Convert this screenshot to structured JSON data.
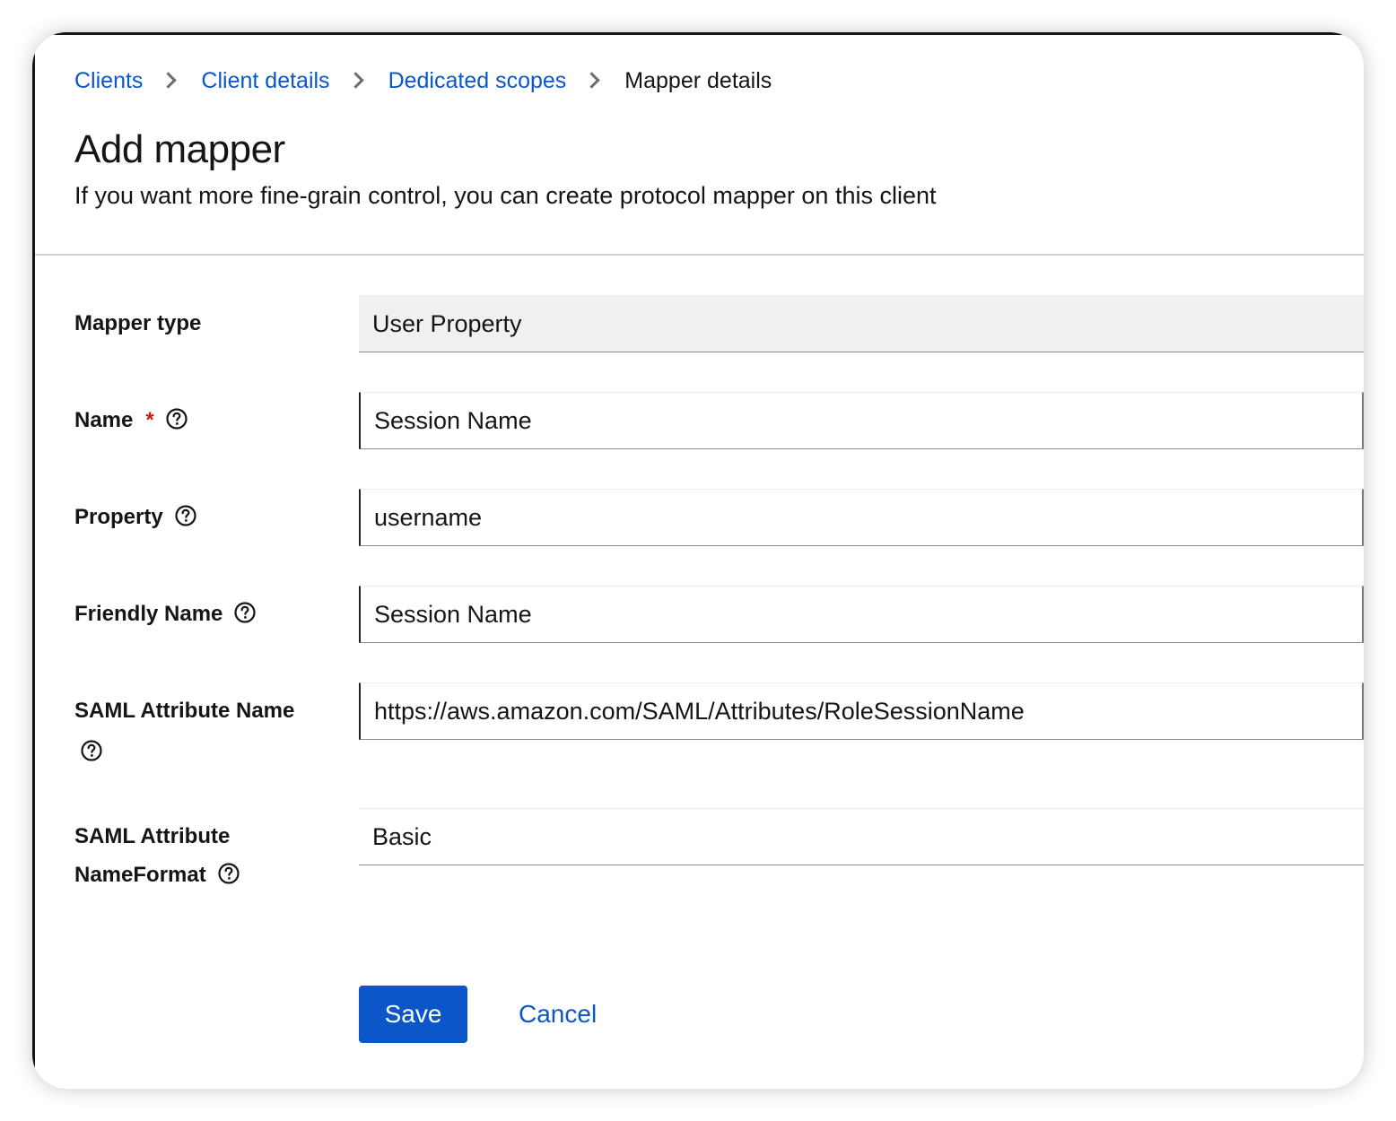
{
  "breadcrumb": {
    "items": [
      {
        "label": "Clients",
        "link": true
      },
      {
        "label": "Client details",
        "link": true
      },
      {
        "label": "Dedicated scopes",
        "link": true
      },
      {
        "label": "Mapper details",
        "link": false
      }
    ]
  },
  "header": {
    "title": "Add mapper",
    "subtitle": "If you want more fine-grain control, you can create protocol mapper on this client"
  },
  "form": {
    "mapper_type": {
      "label": "Mapper type",
      "value": "User Property"
    },
    "name": {
      "label": "Name",
      "required_mark": "*",
      "value": "Session Name"
    },
    "property": {
      "label": "Property",
      "value": "username"
    },
    "friendly_name": {
      "label": "Friendly Name",
      "value": "Session Name"
    },
    "saml_attribute_name": {
      "label": "SAML Attribute Name",
      "value": "https://aws.amazon.com/SAML/Attributes/RoleSessionName"
    },
    "saml_attribute_nameformat": {
      "label_line1": "SAML Attribute",
      "label_line2": "NameFormat",
      "value": "Basic"
    }
  },
  "actions": {
    "save_label": "Save",
    "cancel_label": "Cancel"
  },
  "icons": {
    "help": "help-circle-icon",
    "separator": "chevron-right-icon"
  },
  "colors": {
    "link": "#0b57c9",
    "primary_button": "#0b57c9",
    "required": "#c9190b",
    "readonly_field_bg": "#f0f0f0",
    "text": "#151515"
  }
}
